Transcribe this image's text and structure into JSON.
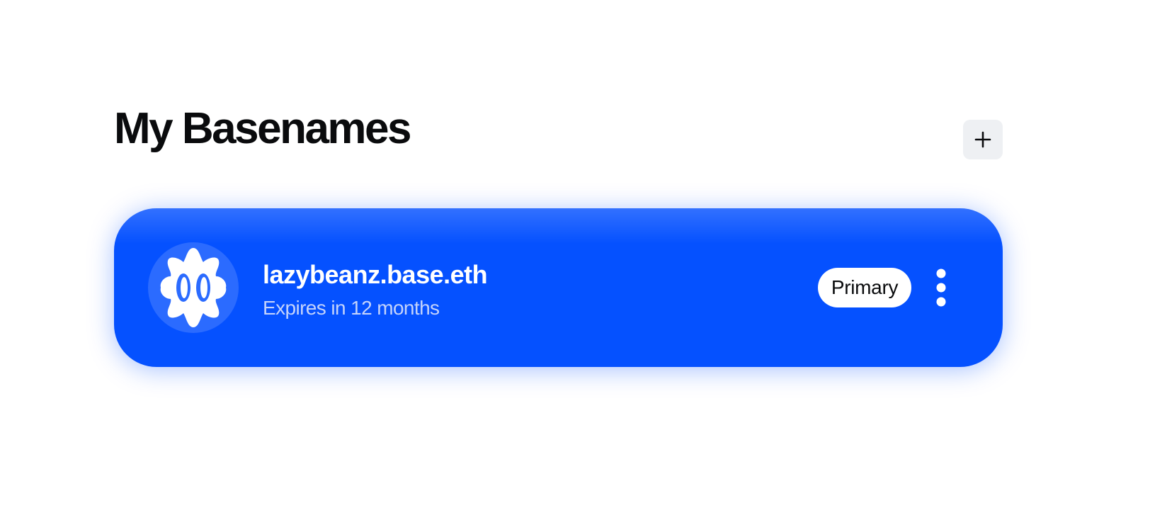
{
  "page": {
    "title": "My Basenames"
  },
  "toolbar": {
    "add_icon": "plus-icon"
  },
  "names": [
    {
      "name": "lazybeanz.base.eth",
      "expiry": "Expires in 12 months",
      "badge": "Primary",
      "avatar_icon": "bean-face-avatar",
      "menu_icon": "vertical-ellipsis-icon"
    }
  ],
  "colors": {
    "card_background": "#0551ff",
    "add_button_background": "#eef0f3",
    "title_text": "#0a0b0d",
    "expiry_text": "#c4d3fb",
    "badge_background": "#ffffff"
  }
}
